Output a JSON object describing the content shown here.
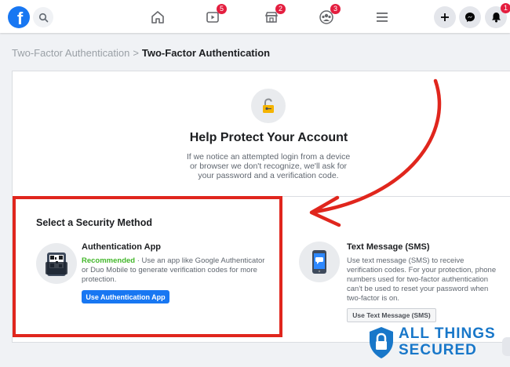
{
  "topbar": {
    "logo_letter": "f",
    "badges": {
      "watch": "5",
      "marketplace": "2",
      "groups": "3",
      "notifications": "1"
    }
  },
  "breadcrumb": {
    "parent": "Two-Factor Authentication",
    "separator": ">",
    "current": "Two-Factor Authentication"
  },
  "header": {
    "title": "Help Protect Your Account",
    "description": "If we notice an attempted login from a device or browser we don't recognize, we'll ask for your password and a verification code."
  },
  "methods": {
    "section_title": "Select a Security Method",
    "auth_app": {
      "name": "Authentication App",
      "recommended": "Recommended",
      "description": " · Use an app like Google Authenticator or Duo Mobile to generate verification codes for more protection.",
      "button": "Use Authentication App"
    },
    "sms": {
      "name": "Text Message (SMS)",
      "description": "Use text message (SMS) to receive verification codes. For your protection, phone numbers used for two-factor authentication can't be used to reset your password when two-factor is on.",
      "button": "Use Text Message (SMS)"
    }
  },
  "watermark": {
    "line1": "ALL THINGS",
    "line2": "SECURED"
  },
  "colors": {
    "brand": "#1877f2",
    "highlight": "#e0261d",
    "recommended": "#42b72a",
    "badge": "#e41e3f"
  }
}
